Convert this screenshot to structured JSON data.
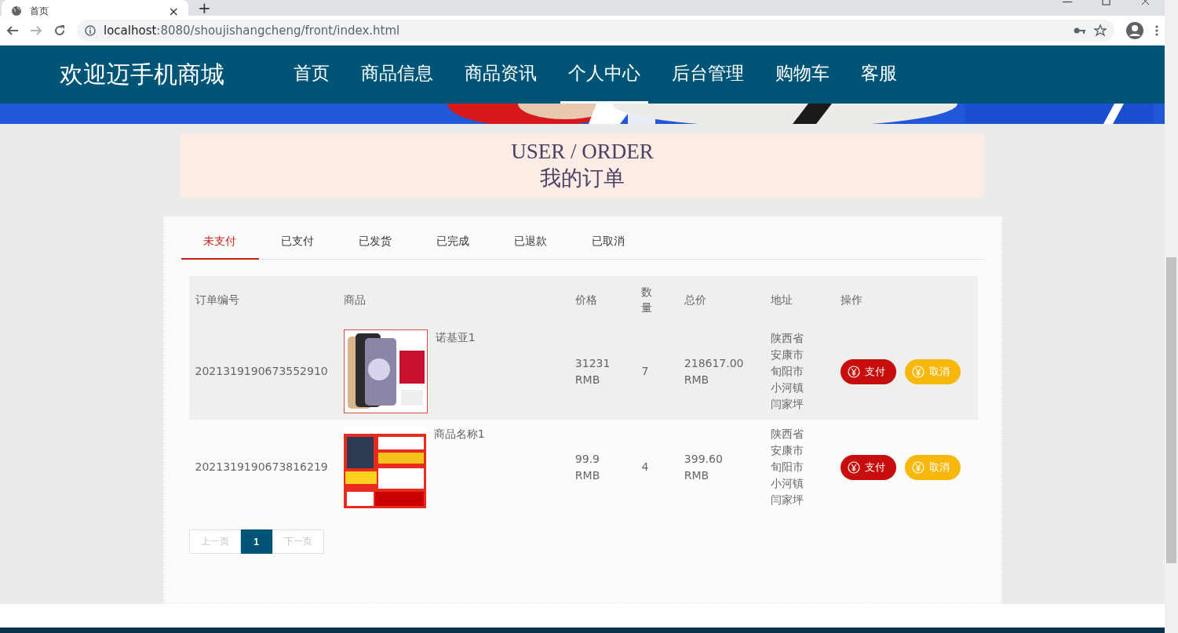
{
  "browser": {
    "tab_title": "首页",
    "tab_close": "×",
    "new_tab": "+",
    "url_host": "localhost",
    "url_path": ":8080/shoujishangcheng/front/index.html"
  },
  "site": {
    "title": "欢迎迈手机商城"
  },
  "nav": [
    {
      "label": "首页",
      "selected": false
    },
    {
      "label": "商品信息",
      "selected": false
    },
    {
      "label": "商品资讯",
      "selected": false
    },
    {
      "label": "个人中心",
      "selected": true
    },
    {
      "label": "后台管理",
      "selected": false
    },
    {
      "label": "购物车",
      "selected": false
    },
    {
      "label": "客服",
      "selected": false
    }
  ],
  "heading": {
    "title_en": "USER / ORDER",
    "title_cn": "我的订单"
  },
  "tabs": [
    {
      "label": "未支付",
      "selected": true
    },
    {
      "label": "已支付",
      "selected": false
    },
    {
      "label": "已发货",
      "selected": false
    },
    {
      "label": "已完成",
      "selected": false
    },
    {
      "label": "已退款",
      "selected": false
    },
    {
      "label": "已取消",
      "selected": false
    }
  ],
  "table": {
    "columns": [
      "订单编号",
      "商品",
      "价格",
      "数量",
      "总价",
      "地址",
      "操作"
    ],
    "rows": [
      {
        "order_no": "2021319190673552910",
        "product": "诺基亚1",
        "price": "31231 RMB",
        "quantity": "7",
        "total": "218617.00 RMB",
        "address": "陕西省安康市旬阳市小河镇闫家坪",
        "highlighted": true,
        "actions": [
          "支付",
          "取消"
        ]
      },
      {
        "order_no": "2021319190673816219",
        "product": "商品名称1",
        "price": "99.9 RMB",
        "quantity": "4",
        "total": "399.60 RMB",
        "address": "陕西省安康市旬阳市小河镇闫家坪",
        "highlighted": false,
        "actions": [
          "支付",
          "取消"
        ]
      }
    ]
  },
  "pagination": [
    {
      "label": "上一页",
      "selected": false,
      "disabled": true
    },
    {
      "label": "1",
      "selected": true,
      "disabled": false
    },
    {
      "label": "下一页",
      "selected": false,
      "disabled": true
    }
  ]
}
